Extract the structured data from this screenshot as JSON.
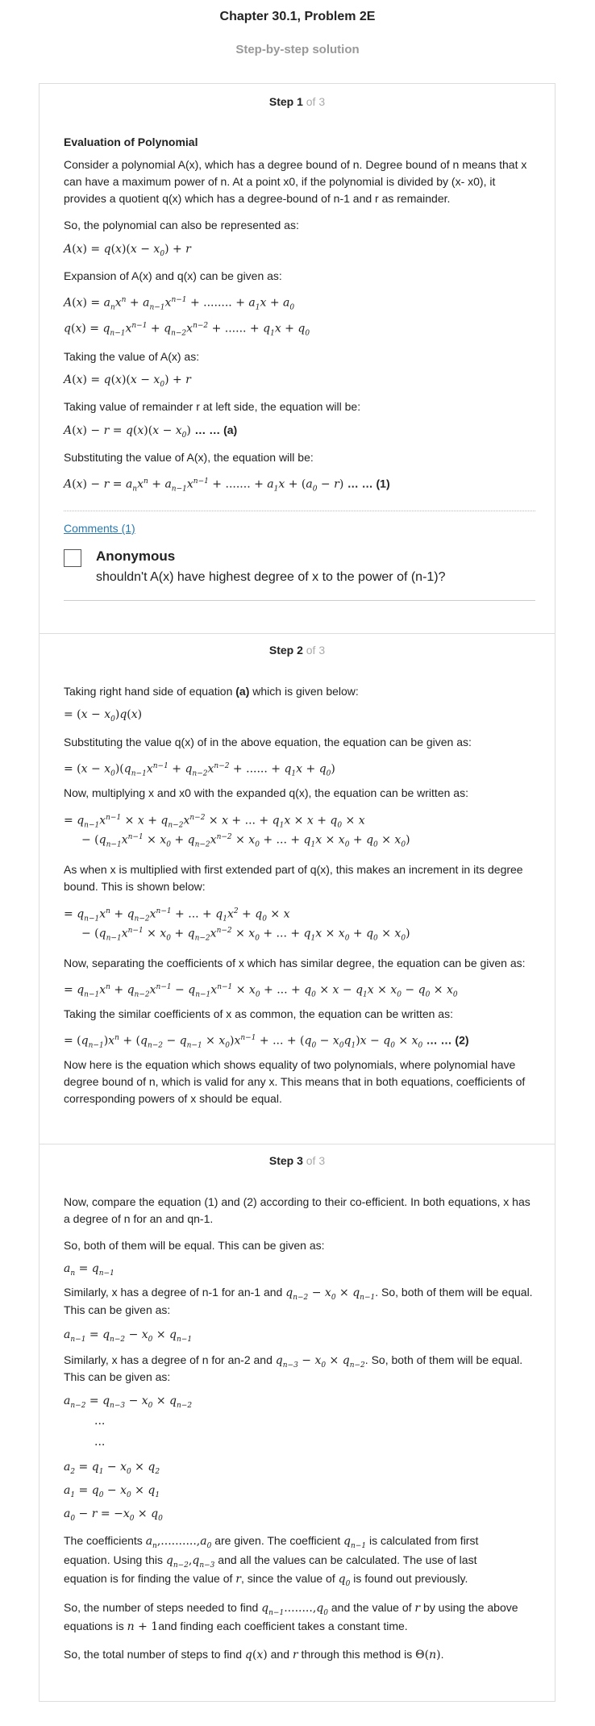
{
  "header": {
    "title": "Chapter 30.1, Problem 2E",
    "subtitle": "Step-by-step solution"
  },
  "step1": {
    "label": "Step 1",
    "of": " of 3",
    "heading": "Evaluation of Polynomial",
    "p1": "Consider a polynomial A(x), which has a degree bound of n. Degree bound of n means that x can have a maximum power of n. At a point x0, if the polynomial is divided by (x- x0), it provides a quotient q(x) which has a degree-bound of n-1 and r as remainder.",
    "p2": "So, the polynomial can also be represented as:",
    "p3": "Expansion of A(x) and q(x) can be given as:",
    "p4": "Taking the value of A(x) as:",
    "p5": "Taking value of remainder r at left side, the equation will be:",
    "tag_a": "… … (a)",
    "p6": "Substituting the value of A(x), the equation will be:",
    "tag_1": "… … (1)"
  },
  "comments": {
    "link": "Comments (1)",
    "author": "Anonymous",
    "text": "shouldn't A(x) have highest degree of x to the power of (n-1)?"
  },
  "step2": {
    "label": "Step 2",
    "of": " of 3",
    "p1_pre": "Taking right hand side of equation ",
    "p1_bold": "(a)",
    "p1_post": " which is given below:",
    "p2": "Substituting the value q(x) of in the above equation, the equation can be given as:",
    "p3": "Now, multiplying x and x0 with the expanded q(x), the equation can be written as:",
    "p4": "As when x is multiplied with first extended part of q(x), this makes an increment in its degree bound. This is shown below:",
    "p5": "Now, separating the coefficients of x which has similar degree, the equation can be given as:",
    "p6": "Taking the similar coefficients of x as common, the equation can be written as:",
    "tag_2": "… … (2)",
    "p7": "Now here is the equation which shows equality of two polynomials, where polynomial have degree bound of n, which is valid for any x. This means that in both equations, coefficients of corresponding powers of x should be equal."
  },
  "step3": {
    "label": "Step 3",
    "of": " of 3",
    "p1": "Now, compare the equation (1) and (2) according to their co-efficient. In both equations, x has a degree of n for an and qn-1.",
    "p2": "So, both of them will be equal. This can be given as:",
    "p3a": "Similarly, x has a degree of n-1 for an-1 and",
    "p3b": ". So, both of them will be equal.",
    "p3c": "This can be given as:",
    "p4a": "Similarly, x has a degree of n for an-2 and",
    "p4b": ". So, both of them will be equal.",
    "p4c": "This can be given as:",
    "p5a": "The coefficients",
    "p5b": "are given. The coefficient",
    "p5c": "is calculated from first",
    "p5d": "equation. Using this",
    "p5e": "and all the values can be calculated. The use of last",
    "p5f": "equation is for finding the value of",
    "p5g": ", since the value of",
    "p5h": "is found out previously.",
    "p6a": "So, the number of steps needed to find",
    "p6b": "and the value of",
    "p6c": "by using the above",
    "p6d": "equations is",
    "p6e": "and finding each coefficient takes a constant time.",
    "p7a": "So, the total number of steps to find",
    "p7b": "and",
    "p7c": "through this method is"
  }
}
